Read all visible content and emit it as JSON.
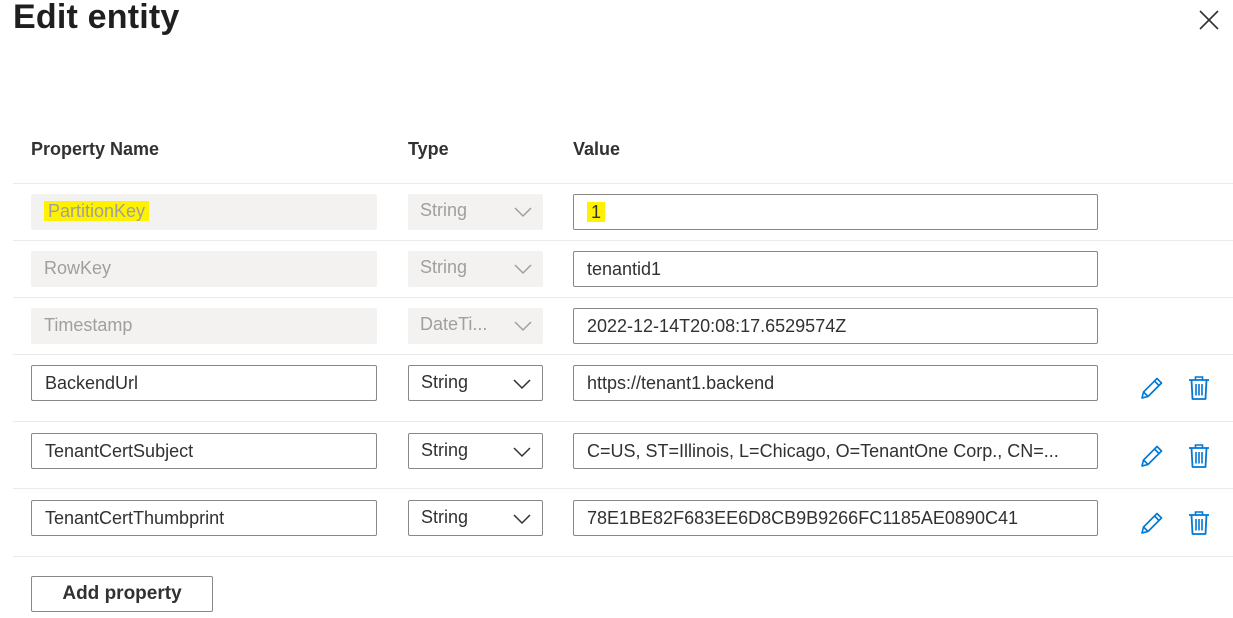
{
  "dialog": {
    "title": "Edit entity",
    "close_icon": "close-icon"
  },
  "columns": {
    "name": "Property Name",
    "type": "Type",
    "value": "Value"
  },
  "rows": [
    {
      "name": "PartitionKey",
      "type": "String",
      "value": "1",
      "editable": false,
      "highlighted": true
    },
    {
      "name": "RowKey",
      "type": "String",
      "value": "tenantid1",
      "editable": false,
      "highlighted": false
    },
    {
      "name": "Timestamp",
      "type": "DateTi...",
      "value": "2022-12-14T20:08:17.6529574Z",
      "editable": false,
      "highlighted": false
    },
    {
      "name": "BackendUrl",
      "type": "String",
      "value": "https://tenant1.backend",
      "editable": true,
      "highlighted": false
    },
    {
      "name": "TenantCertSubject",
      "type": "String",
      "value": "C=US, ST=Illinois, L=Chicago, O=TenantOne Corp., CN=...",
      "editable": true,
      "highlighted": false
    },
    {
      "name": "TenantCertThumbprint",
      "type": "String",
      "value": "78E1BE82F683EE6D8CB9B9266FC1185AE0890C41",
      "editable": true,
      "highlighted": false
    }
  ],
  "icons": {
    "edit": "pencil-icon",
    "delete": "trash-icon",
    "dropdown": "chevron-down-icon"
  },
  "colors": {
    "accent": "#0078d4",
    "highlight": "#fff200",
    "disabled_bg": "#f3f2f1",
    "disabled_text": "#a19f9d"
  },
  "actions": {
    "add_label": "Add property"
  }
}
